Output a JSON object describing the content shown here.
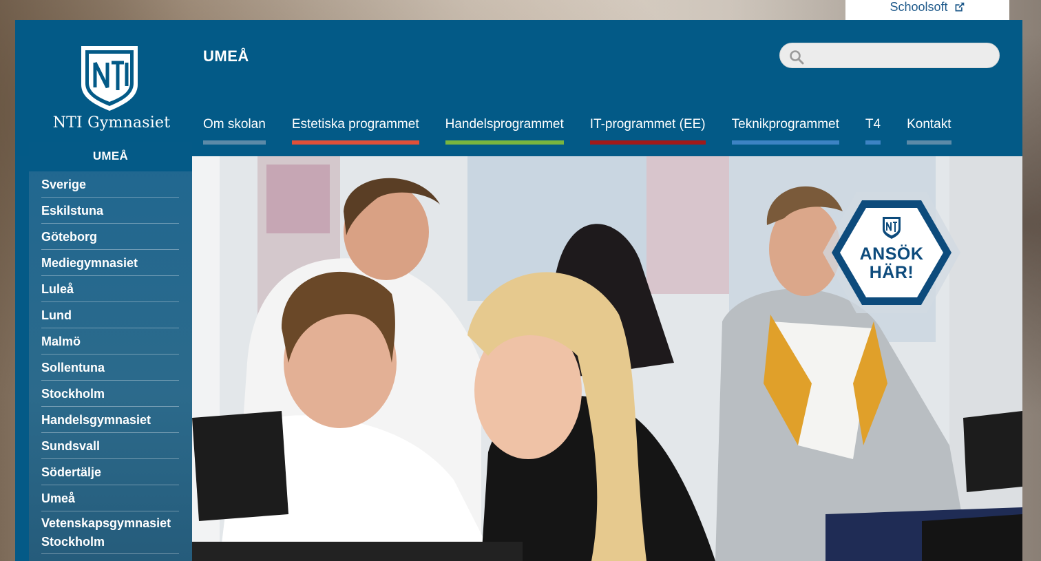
{
  "top_link": {
    "label": "Schoolsoft"
  },
  "brand": {
    "logo_text": "NTI Gymnasiet",
    "shield_letters": "NTI"
  },
  "header": {
    "title": "UMEÅ"
  },
  "search": {
    "placeholder": "",
    "value": ""
  },
  "nav": {
    "items": [
      {
        "label": "Om skolan",
        "color": "#5c8aa8"
      },
      {
        "label": "Estetiska programmet",
        "color": "#e05039"
      },
      {
        "label": "Handelsprogrammet",
        "color": "#79b53f"
      },
      {
        "label": "IT-programmet (EE)",
        "color": "#a01a1a"
      },
      {
        "label": "Teknikprogrammet",
        "color": "#3d83c4"
      },
      {
        "label": "T4",
        "color": "#3d83c4"
      },
      {
        "label": "Kontakt",
        "color": "#5c8aa8"
      }
    ]
  },
  "sidebar": {
    "heading": "UMEÅ",
    "items": [
      {
        "label": "Sverige"
      },
      {
        "label": "Eskilstuna"
      },
      {
        "label": "Göteborg"
      },
      {
        "label": "Mediegymnasiet"
      },
      {
        "label": "Luleå"
      },
      {
        "label": "Lund"
      },
      {
        "label": "Malmö"
      },
      {
        "label": "Sollentuna"
      },
      {
        "label": "Stockholm"
      },
      {
        "label": "Handelsgymnasiet"
      },
      {
        "label": "Sundsvall"
      },
      {
        "label": "Södertälje"
      },
      {
        "label": "Umeå"
      },
      {
        "label": "Vetenskapsgymnasiet Stockholm"
      }
    ]
  },
  "hero": {
    "apply_line1": "ANSÖK",
    "apply_line2": "HÄR!",
    "icon": "students-photo"
  },
  "colors": {
    "brand_blue": "#035a87",
    "link_blue": "#1f5a8b"
  }
}
